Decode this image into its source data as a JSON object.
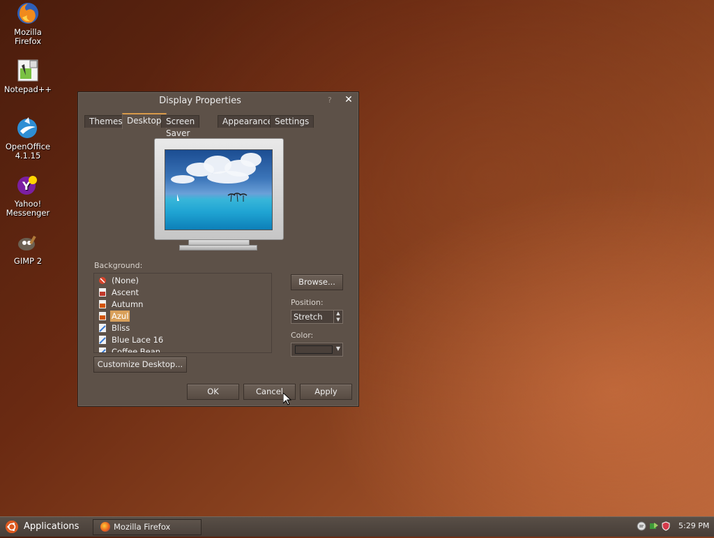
{
  "desktop_icons": [
    {
      "label_lines": [
        "Mozilla",
        "Firefox"
      ],
      "icon": "firefox-icon"
    },
    {
      "label_lines": [
        "Notepad++"
      ],
      "icon": "notepadpp-icon"
    },
    {
      "label_lines": [
        "OpenOffice",
        "4.1.15"
      ],
      "icon": "openoffice-icon"
    },
    {
      "label_lines": [
        "Yahoo!",
        "Messenger"
      ],
      "icon": "yahoo-messenger-icon"
    },
    {
      "label_lines": [
        "GIMP 2"
      ],
      "icon": "gimp-icon"
    }
  ],
  "dialog": {
    "title": "Display Properties",
    "help_glyph": "?",
    "close_glyph": "✕",
    "tabs": [
      "Themes",
      "Desktop",
      "Screen Saver",
      "Appearance",
      "Settings"
    ],
    "active_tab": "Desktop",
    "background_label": "Background:",
    "backgrounds": [
      {
        "label": "(None)",
        "icon": "none-icon"
      },
      {
        "label": "Ascent",
        "icon": "image-file-icon"
      },
      {
        "label": "Autumn",
        "icon": "image-file-icon"
      },
      {
        "label": "Azul",
        "icon": "image-file-icon",
        "selected": true
      },
      {
        "label": "Bliss",
        "icon": "image-file-icon"
      },
      {
        "label": "Blue Lace 16",
        "icon": "image-file-icon"
      },
      {
        "label": "Coffee Bean",
        "icon": "image-file-icon"
      }
    ],
    "browse_label": "Browse...",
    "position_label": "Position:",
    "position_value": "Stretch",
    "color_label": "Color:",
    "color_value": "#4a403a",
    "customize_label": "Customize Desktop...",
    "ok_label": "OK",
    "cancel_label": "Cancel",
    "apply_label": "Apply"
  },
  "taskbar": {
    "applications_label": "Applications",
    "window_button_label": "Mozilla Firefox",
    "clock": "5:29 PM"
  },
  "colors": {
    "accent": "#d9a05a",
    "dialog_bg": "#5d5148"
  }
}
